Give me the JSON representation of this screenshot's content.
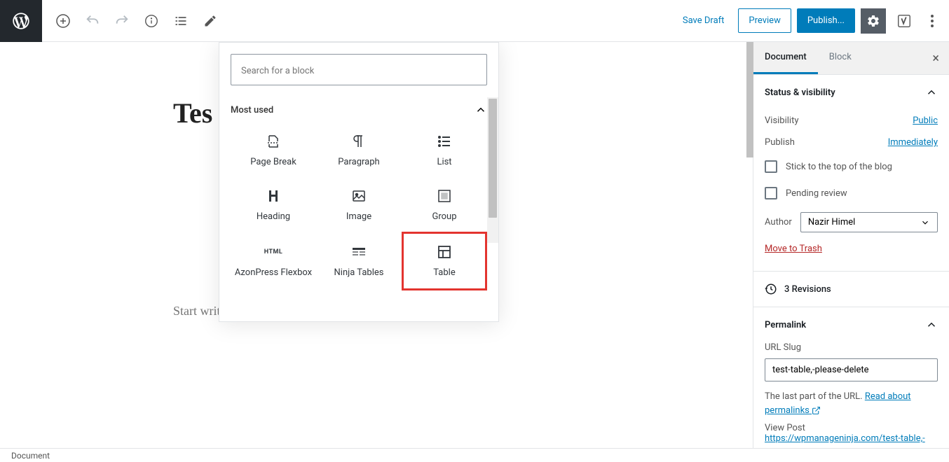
{
  "toolbar": {
    "save_draft": "Save Draft",
    "preview": "Preview",
    "publish": "Publish..."
  },
  "editor": {
    "title_fragment": "Tes",
    "placeholder": "Start writing or type / to choose a block"
  },
  "inserter": {
    "search_placeholder": "Search for a block",
    "section_title": "Most used",
    "blocks": [
      {
        "label": "Page Break"
      },
      {
        "label": "Paragraph"
      },
      {
        "label": "List"
      },
      {
        "label": "Heading"
      },
      {
        "label": "Image"
      },
      {
        "label": "Group"
      },
      {
        "label": "AzonPress Flexbox"
      },
      {
        "label": "Ninja Tables"
      },
      {
        "label": "Table"
      }
    ]
  },
  "sidebar": {
    "tabs": {
      "document": "Document",
      "block": "Block"
    },
    "status": {
      "title": "Status & visibility",
      "visibility_label": "Visibility",
      "visibility_value": "Public",
      "publish_label": "Publish",
      "publish_value": "Immediately",
      "stick": "Stick to the top of the blog",
      "pending": "Pending review",
      "author_label": "Author",
      "author_value": "Nazir Himel",
      "trash": "Move to Trash"
    },
    "revisions": "3 Revisions",
    "permalink": {
      "title": "Permalink",
      "slug_label": "URL Slug",
      "slug_value": "test-table,-please-delete",
      "help_prefix": "The last part of the URL. ",
      "help_link": "Read about permalinks",
      "view_post_label": "View Post",
      "view_post_url": "https://wpmanageninja.com/test-table,-"
    }
  },
  "footer": {
    "breadcrumb": "Document"
  }
}
